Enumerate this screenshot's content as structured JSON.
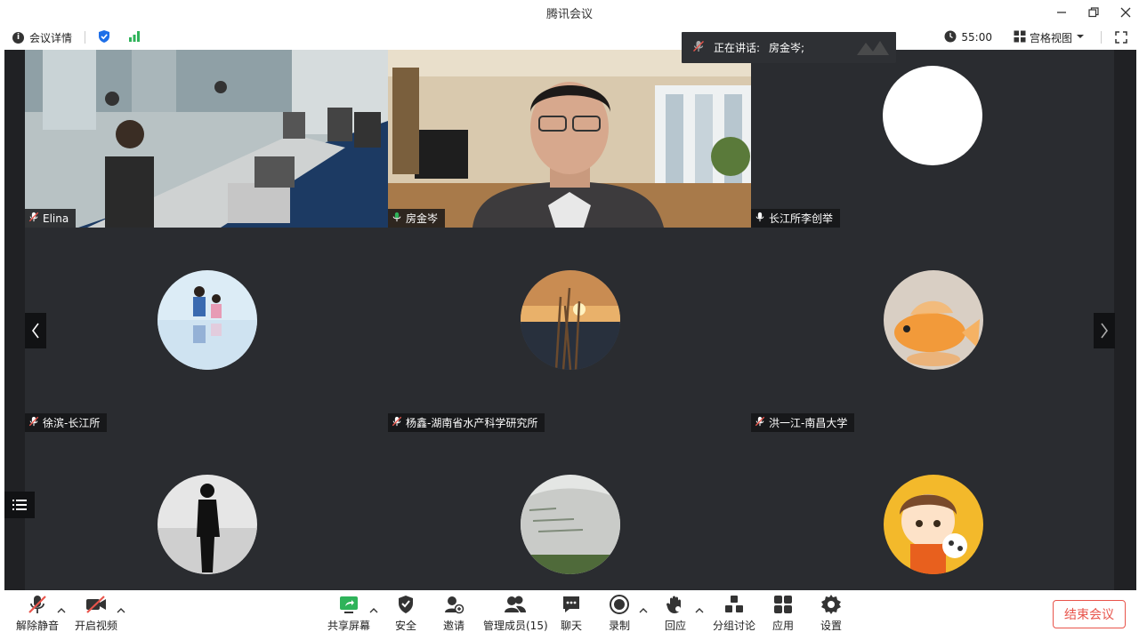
{
  "window": {
    "title": "腾讯会议"
  },
  "infobar": {
    "details_label": "会议详情",
    "timer": "55:00",
    "view_label": "宫格视图"
  },
  "speaking": {
    "prefix": "正在讲话:",
    "name": "房金岑;"
  },
  "participants": [
    {
      "name": "Elina",
      "muted": true
    },
    {
      "name": "房金岑",
      "muted": false
    },
    {
      "name": "长江所李创举",
      "muted": false
    },
    {
      "name": "徐滨-长江所",
      "muted": true
    },
    {
      "name": "杨鑫-湖南省水产科学研究所",
      "muted": true
    },
    {
      "name": "洪一江-南昌大学",
      "muted": true
    },
    {
      "name": "",
      "muted": true
    },
    {
      "name": "",
      "muted": true
    },
    {
      "name": "",
      "muted": true
    }
  ],
  "toolbar": {
    "unmute": "解除静音",
    "start_video": "开启视频",
    "share_screen": "共享屏幕",
    "security": "安全",
    "invite": "邀请",
    "members": "管理成员(15)",
    "chat": "聊天",
    "record": "录制",
    "reaction": "回应",
    "breakout": "分组讨论",
    "apps": "应用",
    "settings": "设置",
    "end_meeting": "结束会议"
  },
  "colors": {
    "accent_green": "#2fb35a",
    "end_red": "#e8544b",
    "shield_blue": "#1e6fe8",
    "stage_bg": "#202124"
  }
}
